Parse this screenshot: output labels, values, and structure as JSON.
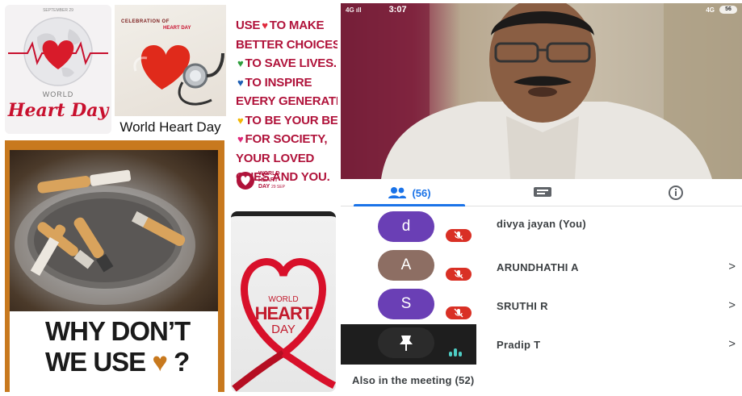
{
  "globe_poster": {
    "date_line": "SEPTEMBER 29",
    "world": "WORLD",
    "heart_day": "Heart Day"
  },
  "steth_poster": {
    "celebration": "CELEBRATION OF",
    "heart_day_small": "HEART DAY",
    "caption": "World Heart Day"
  },
  "use_poster": {
    "lines": [
      {
        "prefix": "USE",
        "heart": "♥",
        "heart_color": "#e0283c",
        "text": "TO MAKE"
      },
      {
        "prefix": "",
        "heart": "",
        "heart_color": "",
        "text": "BETTER CHOICES"
      },
      {
        "prefix": "",
        "heart": "♥",
        "heart_color": "#2e9e3c",
        "text": "TO SAVE LIVES."
      },
      {
        "prefix": "",
        "heart": "♥",
        "heart_color": "#1d5fb4",
        "text": "TO INSPIRE"
      },
      {
        "prefix": "",
        "heart": "",
        "heart_color": "",
        "text": "EVERY GENERATIO"
      },
      {
        "prefix": "",
        "heart": "♥",
        "heart_color": "#f2b705",
        "text": "TO BE YOUR BE"
      },
      {
        "prefix": "",
        "heart": "♥",
        "heart_color": "#e0287a",
        "text": "FOR SOCIETY,"
      },
      {
        "prefix": "",
        "heart": "",
        "heart_color": "",
        "text": "YOUR LOVED"
      },
      {
        "prefix": "",
        "heart": "",
        "heart_color": "",
        "text": "ONES AND YOU."
      }
    ],
    "logo_text": "WORLD HEART DAY",
    "logo_date": "29 SEP"
  },
  "cigarette_poster": {
    "line1": "WHY DON’T",
    "line2": "WE USE",
    "heart": "♥",
    "qmark": "?"
  },
  "ribbon_poster": {
    "world": "WORLD",
    "heart": "HEART",
    "day": "DAY"
  },
  "meet": {
    "status": {
      "signal": "4G ıll",
      "time": "3:07",
      "net": "4G",
      "battery": "56"
    },
    "tabs": [
      {
        "label": "(56)",
        "icon": "people-icon",
        "active": true
      },
      {
        "label": "",
        "icon": "chat-icon",
        "active": false
      },
      {
        "label": "",
        "icon": "info-icon",
        "active": false
      }
    ],
    "participants": [
      {
        "initial": "d",
        "name": "divya jayan (You)",
        "avatar_color": "#6a3fb5",
        "muted": true,
        "chevron": ""
      },
      {
        "initial": "A",
        "name": "ARUNDHATHI A",
        "avatar_color": "#8d6e63",
        "muted": true,
        "chevron": ">"
      },
      {
        "initial": "S",
        "name": "SRUTHI R",
        "avatar_color": "#6a3fb5",
        "muted": true,
        "chevron": ">"
      },
      {
        "initial": "",
        "name": "Pradip T",
        "avatar_color": "#2b2b2b",
        "muted": false,
        "chevron": ">"
      }
    ],
    "also_label": "Also in the meeting (52)"
  },
  "colors": {
    "accent": "#1a73e8",
    "mute_red": "#d93025",
    "poster_red": "#c8102e",
    "cig_orange": "#c8791e"
  }
}
